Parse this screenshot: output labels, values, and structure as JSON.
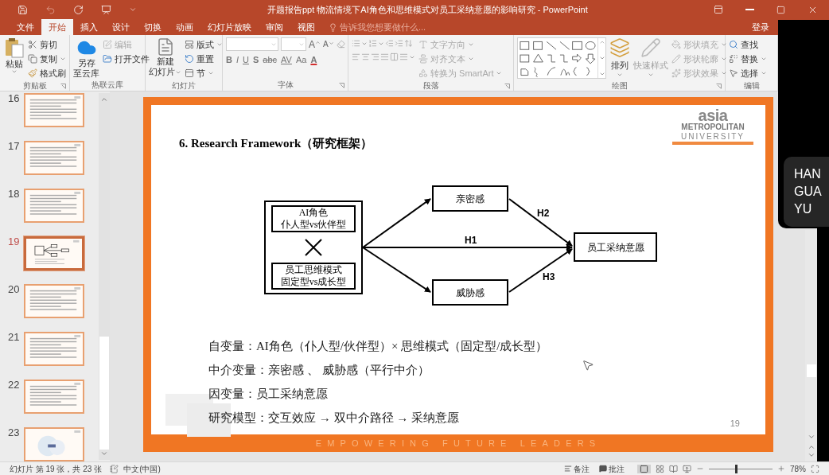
{
  "title_bar": {
    "title": "开题报告ppt 物流情境下AI角色和思维模式对员工采纳意愿的影响研究 - PowerPoint"
  },
  "tabs": [
    {
      "label": "文件",
      "selected": false
    },
    {
      "label": "开始",
      "selected": true
    },
    {
      "label": "插入",
      "selected": false
    },
    {
      "label": "设计",
      "selected": false
    },
    {
      "label": "切换",
      "selected": false
    },
    {
      "label": "动画",
      "selected": false
    },
    {
      "label": "幻灯片放映",
      "selected": false
    },
    {
      "label": "审阅",
      "selected": false
    },
    {
      "label": "视图",
      "selected": false
    }
  ],
  "tell_me": {
    "placeholder": "告诉我您想要做什么..."
  },
  "sign_in": "登录",
  "ribbon": {
    "clipboard": {
      "paste": "粘贴",
      "cut": "剪切",
      "copy": "复制",
      "format_painter": "格式刷",
      "label": "剪贴板"
    },
    "cloud": {
      "save_lines": [
        "另存",
        "至云库"
      ],
      "items": [
        {
          "label": "编辑",
          "disabled": true
        },
        {
          "label": "打开文件",
          "disabled": false
        }
      ],
      "label": "热联云库"
    },
    "slides": {
      "new_lines": [
        "新建",
        "幻灯片"
      ],
      "layout": "版式",
      "reset": "重置",
      "section": "节",
      "label": "幻灯片"
    },
    "font": {
      "grow": "A",
      "shrink": "A",
      "buttons": [
        {
          "kind": "bold",
          "text": "B"
        },
        {
          "kind": "italic",
          "text": "I"
        },
        {
          "kind": "underline",
          "text": "U"
        },
        {
          "kind": "shadow",
          "text": "S"
        },
        {
          "kind": "strike",
          "text": "abc"
        },
        {
          "kind": "spacing",
          "text": "AV"
        },
        {
          "kind": "case",
          "text": "Aa"
        },
        {
          "kind": "color",
          "text": "A"
        }
      ],
      "label": "字体"
    },
    "paragraph": {
      "items": [
        {
          "label": "文字方向",
          "disabled": true
        },
        {
          "label": "对齐文本",
          "disabled": true
        },
        {
          "label": "转换为 SmartArt",
          "disabled": true
        }
      ],
      "label": "段落"
    },
    "drawing": {
      "arrange": "排列",
      "quick_styles": {
        "label": "快速样式",
        "disabled": true
      },
      "items": [
        {
          "label": "形状填充",
          "disabled": true
        },
        {
          "label": "形状轮廓",
          "disabled": true
        },
        {
          "label": "形状效果",
          "disabled": true
        }
      ],
      "label": "绘图"
    },
    "editing": {
      "find": "查找",
      "replace": "替换",
      "select": "选择",
      "label": "编辑"
    }
  },
  "thumbnails": [
    {
      "number": "16",
      "kind": "text",
      "selected": false
    },
    {
      "number": "17",
      "kind": "text",
      "selected": false
    },
    {
      "number": "18",
      "kind": "text",
      "selected": false
    },
    {
      "number": "19",
      "kind": "diagram",
      "selected": true
    },
    {
      "number": "20",
      "kind": "text",
      "selected": false
    },
    {
      "number": "21",
      "kind": "text",
      "selected": false
    },
    {
      "number": "22",
      "kind": "text",
      "selected": false
    },
    {
      "number": "23",
      "kind": "closing",
      "selected": false
    }
  ],
  "slide": {
    "title": "6. Research Framework（研究框架）",
    "logo": {
      "line_1": "asia",
      "line_2": "METROPOLITAN",
      "line_3": "UNIVERSITY"
    },
    "diagram": {
      "factor_1": [
        "AI角色",
        "仆人型vs伙伴型"
      ],
      "factor_2": [
        "员工思维模式",
        "固定型vs成长型"
      ],
      "mediator_1": "亲密感",
      "mediator_2": "威胁感",
      "outcome": "员工采纳意愿",
      "paths": [
        "H1",
        "H2",
        "H3"
      ]
    },
    "bullets": [
      "自变量：AI角色（仆人型/伙伴型）× 思维模式（固定型/成长型）",
      "中介变量：亲密感 、 威胁感（平行中介）",
      "因变量：员工采纳意愿",
      "研究模型：交互效应 → 双中介路径 → 采纳意愿"
    ],
    "page_number": "19",
    "footer": "EMPOWERING FUTURE LEADERS"
  },
  "status_bar": {
    "slide_info": "幻灯片 第 19 张，共 23 张",
    "language": "中文(中国)",
    "notes": "备注",
    "comments": "批注",
    "zoom": {
      "level": 0.43,
      "reading": "78%"
    }
  },
  "call_overlay": {
    "name_lines": [
      "HAN",
      "GUA",
      "YU"
    ]
  }
}
